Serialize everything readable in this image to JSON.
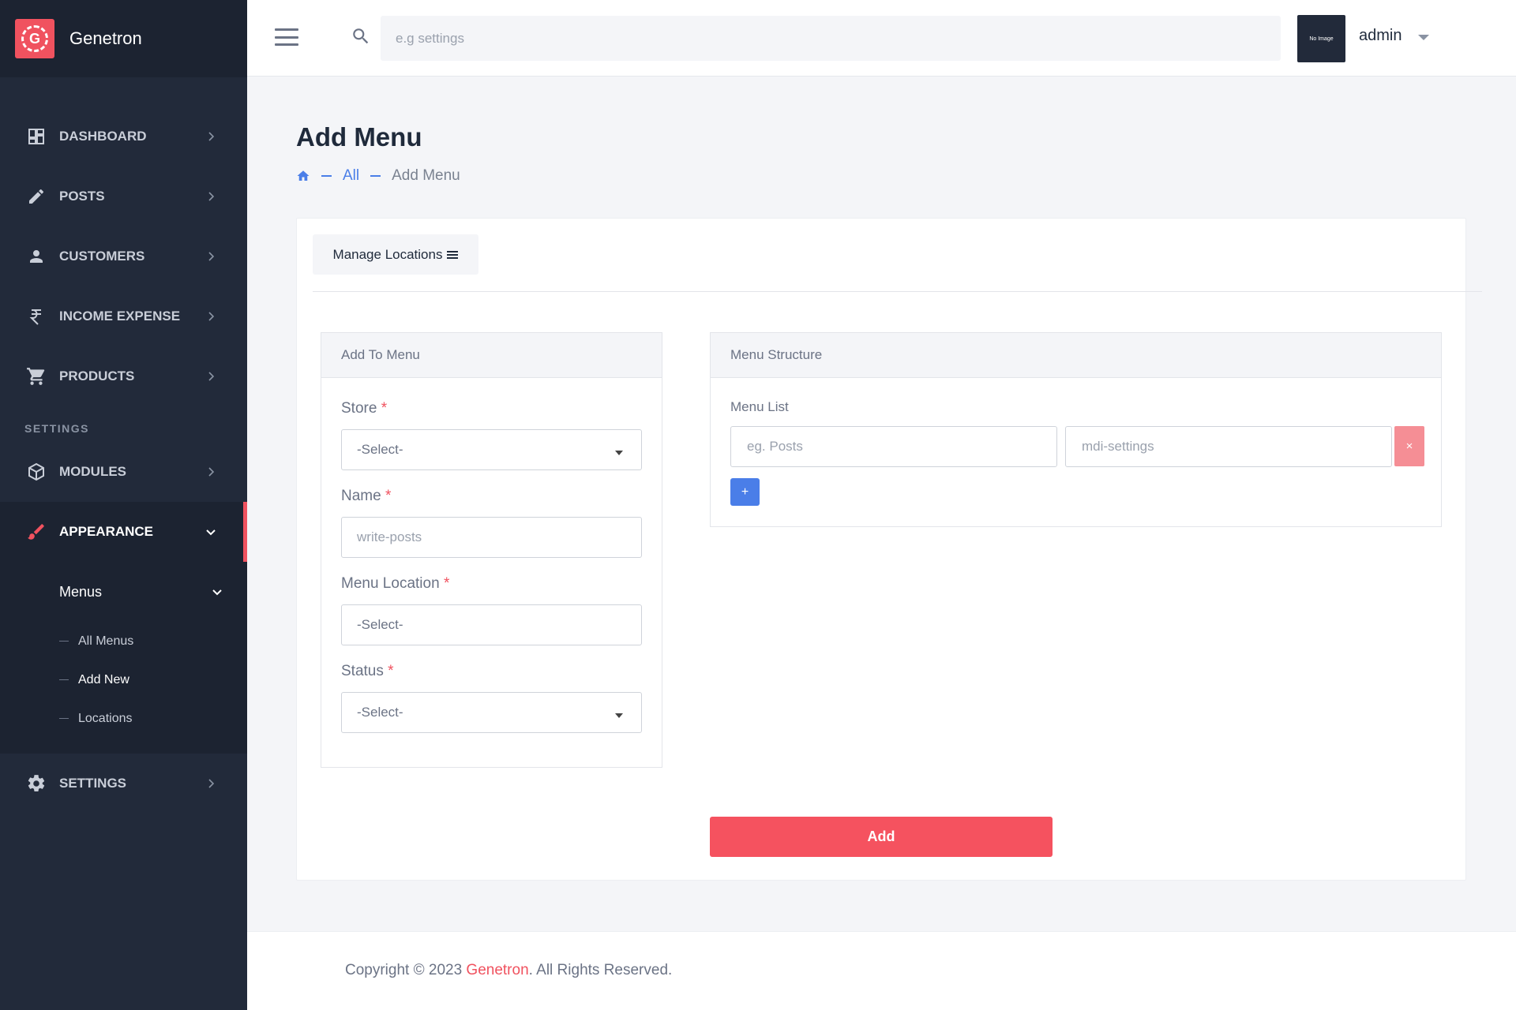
{
  "brand": {
    "name": "Genetron",
    "logo_letter": "G",
    "accent": "#f0525f"
  },
  "sidebar": {
    "items": [
      {
        "label": "DASHBOARD",
        "icon": "dashboard-icon"
      },
      {
        "label": "POSTS",
        "icon": "pencil-icon"
      },
      {
        "label": "CUSTOMERS",
        "icon": "user-icon"
      },
      {
        "label": "INCOME EXPENSE",
        "icon": "rupee-icon"
      },
      {
        "label": "PRODUCTS",
        "icon": "cart-icon"
      }
    ],
    "section_label": "SETTINGS",
    "settings_items": [
      {
        "label": "MODULES",
        "icon": "package-icon"
      },
      {
        "label": "APPEARANCE",
        "icon": "brush-icon"
      },
      {
        "label": "SETTINGS",
        "icon": "gear-icon"
      }
    ],
    "submenu": {
      "title": "Menus",
      "links": [
        "All Menus",
        "Add New",
        "Locations"
      ]
    }
  },
  "topbar": {
    "search_placeholder": "e.g settings",
    "avatar_text": "No Image",
    "user_name": "admin"
  },
  "page": {
    "title": "Add Menu",
    "breadcrumb": {
      "all": "All",
      "current": "Add Menu"
    }
  },
  "card": {
    "manage_locations": "Manage Locations",
    "add_to_menu": {
      "title": "Add To Menu",
      "store_label": "Store",
      "store_value": "-Select-",
      "name_label": "Name",
      "name_placeholder": "write-posts",
      "menu_location_label": "Menu Location",
      "menu_location_value": "-Select-",
      "status_label": "Status",
      "status_value": "-Select-",
      "required_mark": "*"
    },
    "menu_structure": {
      "title": "Menu Structure",
      "menu_list_label": "Menu List",
      "item_placeholder": "eg. Posts",
      "icon_placeholder": "mdi-settings",
      "remove_label": "×",
      "add_row_label": "+"
    },
    "submit_label": "Add"
  },
  "footer": {
    "prefix": "Copyright © 2023 ",
    "brand": "Genetron",
    "suffix": ". All Rights Reserved."
  }
}
